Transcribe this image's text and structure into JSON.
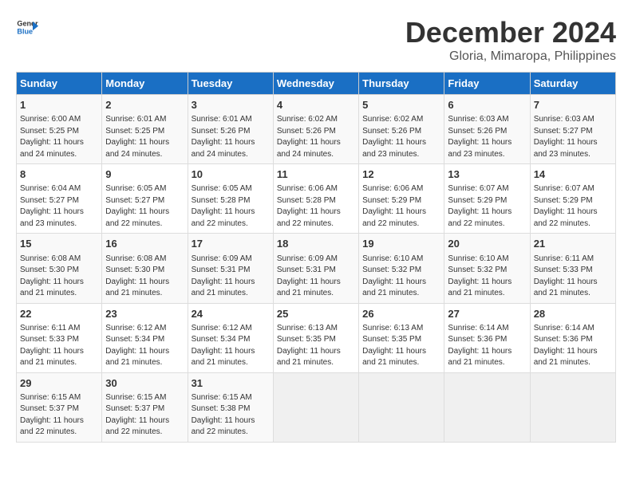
{
  "logo": {
    "general": "General",
    "blue": "Blue"
  },
  "title": {
    "month": "December 2024",
    "location": "Gloria, Mimaropa, Philippines"
  },
  "headers": [
    "Sunday",
    "Monday",
    "Tuesday",
    "Wednesday",
    "Thursday",
    "Friday",
    "Saturday"
  ],
  "weeks": [
    [
      {
        "day": "1",
        "content": "Sunrise: 6:00 AM\nSunset: 5:25 PM\nDaylight: 11 hours and 24 minutes."
      },
      {
        "day": "2",
        "content": "Sunrise: 6:01 AM\nSunset: 5:25 PM\nDaylight: 11 hours and 24 minutes."
      },
      {
        "day": "3",
        "content": "Sunrise: 6:01 AM\nSunset: 5:26 PM\nDaylight: 11 hours and 24 minutes."
      },
      {
        "day": "4",
        "content": "Sunrise: 6:02 AM\nSunset: 5:26 PM\nDaylight: 11 hours and 24 minutes."
      },
      {
        "day": "5",
        "content": "Sunrise: 6:02 AM\nSunset: 5:26 PM\nDaylight: 11 hours and 23 minutes."
      },
      {
        "day": "6",
        "content": "Sunrise: 6:03 AM\nSunset: 5:26 PM\nDaylight: 11 hours and 23 minutes."
      },
      {
        "day": "7",
        "content": "Sunrise: 6:03 AM\nSunset: 5:27 PM\nDaylight: 11 hours and 23 minutes."
      }
    ],
    [
      {
        "day": "8",
        "content": "Sunrise: 6:04 AM\nSunset: 5:27 PM\nDaylight: 11 hours and 23 minutes."
      },
      {
        "day": "9",
        "content": "Sunrise: 6:05 AM\nSunset: 5:27 PM\nDaylight: 11 hours and 22 minutes."
      },
      {
        "day": "10",
        "content": "Sunrise: 6:05 AM\nSunset: 5:28 PM\nDaylight: 11 hours and 22 minutes."
      },
      {
        "day": "11",
        "content": "Sunrise: 6:06 AM\nSunset: 5:28 PM\nDaylight: 11 hours and 22 minutes."
      },
      {
        "day": "12",
        "content": "Sunrise: 6:06 AM\nSunset: 5:29 PM\nDaylight: 11 hours and 22 minutes."
      },
      {
        "day": "13",
        "content": "Sunrise: 6:07 AM\nSunset: 5:29 PM\nDaylight: 11 hours and 22 minutes."
      },
      {
        "day": "14",
        "content": "Sunrise: 6:07 AM\nSunset: 5:29 PM\nDaylight: 11 hours and 22 minutes."
      }
    ],
    [
      {
        "day": "15",
        "content": "Sunrise: 6:08 AM\nSunset: 5:30 PM\nDaylight: 11 hours and 21 minutes."
      },
      {
        "day": "16",
        "content": "Sunrise: 6:08 AM\nSunset: 5:30 PM\nDaylight: 11 hours and 21 minutes."
      },
      {
        "day": "17",
        "content": "Sunrise: 6:09 AM\nSunset: 5:31 PM\nDaylight: 11 hours and 21 minutes."
      },
      {
        "day": "18",
        "content": "Sunrise: 6:09 AM\nSunset: 5:31 PM\nDaylight: 11 hours and 21 minutes."
      },
      {
        "day": "19",
        "content": "Sunrise: 6:10 AM\nSunset: 5:32 PM\nDaylight: 11 hours and 21 minutes."
      },
      {
        "day": "20",
        "content": "Sunrise: 6:10 AM\nSunset: 5:32 PM\nDaylight: 11 hours and 21 minutes."
      },
      {
        "day": "21",
        "content": "Sunrise: 6:11 AM\nSunset: 5:33 PM\nDaylight: 11 hours and 21 minutes."
      }
    ],
    [
      {
        "day": "22",
        "content": "Sunrise: 6:11 AM\nSunset: 5:33 PM\nDaylight: 11 hours and 21 minutes."
      },
      {
        "day": "23",
        "content": "Sunrise: 6:12 AM\nSunset: 5:34 PM\nDaylight: 11 hours and 21 minutes."
      },
      {
        "day": "24",
        "content": "Sunrise: 6:12 AM\nSunset: 5:34 PM\nDaylight: 11 hours and 21 minutes."
      },
      {
        "day": "25",
        "content": "Sunrise: 6:13 AM\nSunset: 5:35 PM\nDaylight: 11 hours and 21 minutes."
      },
      {
        "day": "26",
        "content": "Sunrise: 6:13 AM\nSunset: 5:35 PM\nDaylight: 11 hours and 21 minutes."
      },
      {
        "day": "27",
        "content": "Sunrise: 6:14 AM\nSunset: 5:36 PM\nDaylight: 11 hours and 21 minutes."
      },
      {
        "day": "28",
        "content": "Sunrise: 6:14 AM\nSunset: 5:36 PM\nDaylight: 11 hours and 21 minutes."
      }
    ],
    [
      {
        "day": "29",
        "content": "Sunrise: 6:15 AM\nSunset: 5:37 PM\nDaylight: 11 hours and 22 minutes."
      },
      {
        "day": "30",
        "content": "Sunrise: 6:15 AM\nSunset: 5:37 PM\nDaylight: 11 hours and 22 minutes."
      },
      {
        "day": "31",
        "content": "Sunrise: 6:15 AM\nSunset: 5:38 PM\nDaylight: 11 hours and 22 minutes."
      },
      {
        "day": "",
        "content": ""
      },
      {
        "day": "",
        "content": ""
      },
      {
        "day": "",
        "content": ""
      },
      {
        "day": "",
        "content": ""
      }
    ]
  ]
}
